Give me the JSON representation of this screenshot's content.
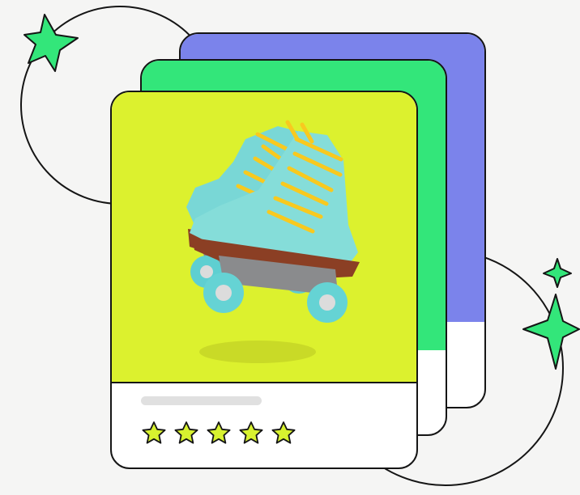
{
  "colors": {
    "background": "#f5f5f4",
    "back_card_top": "#7b83eb",
    "middle_card_top": "#33e67a",
    "front_card_top": "#dcf12e",
    "sparkle": "#33e67a",
    "star_fill": "#d8f22f",
    "star_stroke": "#151515",
    "placeholder_bar": "#e0e0e0"
  },
  "illustration": {
    "subject": "roller-skates",
    "card_count": 3,
    "sparkle_count": 3
  },
  "rating": {
    "stars_filled": 5,
    "stars_total": 5
  },
  "icons": [
    "sparkle-icon",
    "star-icon"
  ]
}
